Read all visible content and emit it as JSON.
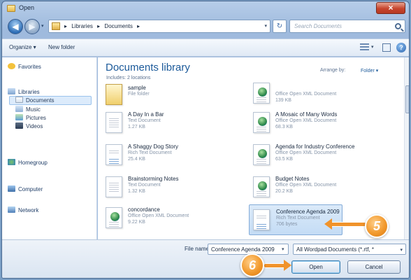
{
  "window": {
    "title": "Open",
    "close_glyph": "×"
  },
  "nav": {
    "back_glyph": "◀",
    "forward_glyph": "▶",
    "recent_glyph": "▾",
    "breadcrumbs": [
      "▸",
      "Libraries",
      "▸",
      "Documents",
      "▸"
    ],
    "address_dd": "▾",
    "refresh_glyph": "↻",
    "search_placeholder": "Search Documents"
  },
  "toolbar": {
    "organize": "Organize ▾",
    "new_folder": "New folder",
    "view_dd": "▾",
    "help_glyph": "?"
  },
  "sidebar": {
    "favorites": "Favorites",
    "libraries": "Libraries",
    "documents": "Documents",
    "music": "Music",
    "pictures": "Pictures",
    "videos": "Videos",
    "homegroup": "Homegroup",
    "computer": "Computer",
    "network": "Network"
  },
  "library": {
    "title": "Documents library",
    "subtitle": "Includes: 2 locations",
    "arrange_label": "Arrange by:",
    "arrange_value": "Folder ▾"
  },
  "files": [
    {
      "name": "sample",
      "type": "File folder",
      "size": ""
    },
    {
      "name": "",
      "type": "Office Open XML Document",
      "size": "139 KB"
    },
    {
      "name": "A Day In a Bar",
      "type": "Text Document",
      "size": "1.27 KB"
    },
    {
      "name": "A Mosaic of Many Words",
      "type": "Office Open XML Document",
      "size": "68.3 KB"
    },
    {
      "name": "A Shaggy Dog Story",
      "type": "Rich Text Document",
      "size": "25.4 KB"
    },
    {
      "name": "Agenda for Industry Conference",
      "type": "Office Open XML Document",
      "size": "63.5 KB"
    },
    {
      "name": "Brainstorming Notes",
      "type": "Text Document",
      "size": "1.32 KB"
    },
    {
      "name": "Budget Notes",
      "type": "Office Open XML Document",
      "size": "20.2 KB"
    },
    {
      "name": "concordance",
      "type": "Office Open XML Document",
      "size": "9.22 KB"
    },
    {
      "name": "Conference Agenda 2009",
      "type": "Rich Text Document",
      "size": "706 bytes"
    }
  ],
  "footer": {
    "filename_label": "File name:",
    "filename_value": "Conference Agenda 2009",
    "filename_dd": "▾",
    "filter_value": "All Wordpad Documents (*.rtf, *",
    "filter_dd": "▾",
    "open": "Open",
    "cancel": "Cancel"
  },
  "callouts": {
    "step5": "5",
    "step6": "6"
  },
  "colors": {
    "accent": "#1c5a9a",
    "callout": "#f29a2e",
    "selection": "#c4dcf5"
  }
}
